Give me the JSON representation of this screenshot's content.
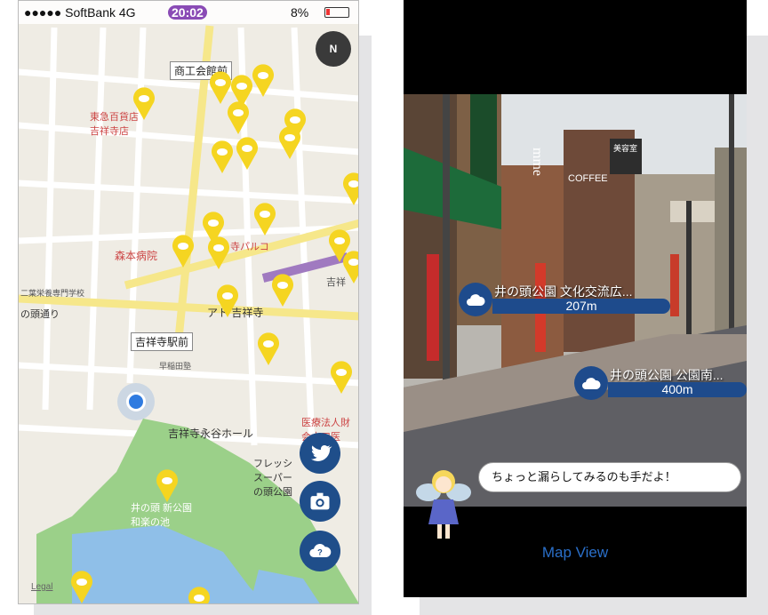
{
  "left_phone": {
    "status": {
      "carrier": "●●●●● SoftBank 4G",
      "time": "20:02",
      "battery": "8%"
    },
    "map_labels": {
      "shoukaikan": "商工会館前",
      "tokyu": "東急百貨店\n吉祥寺店",
      "kichijoji_park": "寺パルコ",
      "moriya": "森本病院",
      "school": "二葉栄養専門学校",
      "inokashira": "の頭通り",
      "kichi_east": "吉祥",
      "ato": "アト 吉祥寺",
      "station": "吉祥寺駅前",
      "waseda": "早稲田塾",
      "hall": "吉祥寺永谷ホール",
      "hospital": "医療法人財\n会水口医",
      "fresh": "フレッシ\nスーパー\nの頭公園",
      "park_inn": "井の頭 新公園\n和楽の池",
      "legal": "Legal"
    },
    "fab": [
      {
        "name": "twitter",
        "icon": "bird-icon"
      },
      {
        "name": "camera",
        "icon": "camera-icon"
      },
      {
        "name": "help",
        "icon": "question-cloud-icon"
      }
    ],
    "compass": "N",
    "colors": {
      "pin": "#f5d521",
      "fab": "#1f4e8a",
      "road": "#ffffff",
      "major_road": "#f6e78a",
      "park": "#9bd089",
      "water": "#8fbfe8"
    }
  },
  "right_phone": {
    "pois": [
      {
        "name": "井の頭公園 文化交流広...",
        "distance": "207m"
      },
      {
        "name": "井の頭公園 公園南...",
        "distance": "400m"
      }
    ],
    "speech": "ちょっと漏らしてみるのも手だよ！",
    "map_view": "Map View",
    "store_signs": {
      "coffee": "COFFEE",
      "biyoushitsu": "美容室",
      "mme": "mme"
    }
  }
}
